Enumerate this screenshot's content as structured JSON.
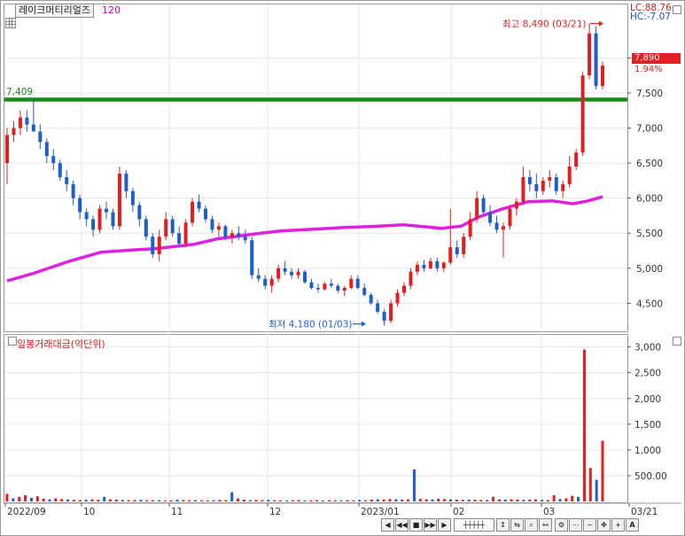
{
  "header": {
    "stock_name": "레이크머티리얼즈",
    "ma_period": "120",
    "lc_text": "LC:88.76",
    "hc_text": "HC:-7.07"
  },
  "price_panel": {
    "current_price": "7,890",
    "change_pct": "1.94%",
    "hline_value": 7409,
    "hline_label": "7,409",
    "max_label": "최고 8,490 (03/21)",
    "min_label": "최저 4,180 (01/03)",
    "y_ticks": [
      "8,000",
      "7,500",
      "7,000",
      "6,500",
      "6,000",
      "5,500",
      "5,000",
      "4,500"
    ]
  },
  "volume_panel": {
    "title": "일봉거래대금(억단위)",
    "y_ticks": [
      "3,000",
      "2,500",
      "2,000",
      "1,500",
      "1,000",
      "500.00"
    ]
  },
  "x_axis": {
    "labels": [
      "2022/09",
      "10",
      "11",
      "12",
      "2023/01",
      "02",
      "03"
    ],
    "end_label": "03/21"
  },
  "colors": {
    "up": "#e02020",
    "down": "#1f5fc8",
    "ma": "#e020e0",
    "hline": "#1a8a1a",
    "grid": "#e6e6e6"
  },
  "chart_data": [
    {
      "type": "candlestick",
      "title": "레이크머티리얼즈",
      "x_labels": [
        "2022/09",
        "10",
        "11",
        "12",
        "2023/01",
        "02",
        "03"
      ],
      "y_range": [
        4100,
        8700
      ],
      "hline": 7409,
      "ma_period": 120,
      "series": [
        {
          "name": "price",
          "ohlc": [
            [
              6500,
              7000,
              6200,
              6900
            ],
            [
              6900,
              7100,
              6800,
              7000
            ],
            [
              7000,
              7250,
              6900,
              7150
            ],
            [
              7150,
              7250,
              6950,
              7050
            ],
            [
              7050,
              7409,
              6950,
              6950
            ],
            [
              6950,
              7050,
              6700,
              6800
            ],
            [
              6800,
              6850,
              6500,
              6600
            ],
            [
              6600,
              6700,
              6400,
              6500
            ],
            [
              6500,
              6550,
              6250,
              6300
            ],
            [
              6300,
              6400,
              6100,
              6200
            ],
            [
              6200,
              6250,
              5900,
              6000
            ],
            [
              6000,
              6050,
              5700,
              5800
            ],
            [
              5800,
              5850,
              5600,
              5700
            ],
            [
              5700,
              5750,
              5450,
              5550
            ],
            [
              5550,
              5900,
              5500,
              5850
            ],
            [
              5850,
              5950,
              5700,
              5800
            ],
            [
              5800,
              5850,
              5550,
              5600
            ],
            [
              5600,
              6450,
              5550,
              6350
            ],
            [
              6350,
              6400,
              6000,
              6100
            ],
            [
              6100,
              6150,
              5800,
              5900
            ],
            [
              5900,
              5950,
              5600,
              5700
            ],
            [
              5700,
              5750,
              5400,
              5450
            ],
            [
              5450,
              5500,
              5150,
              5200
            ],
            [
              5200,
              5550,
              5100,
              5450
            ],
            [
              5450,
              5800,
              5400,
              5700
            ],
            [
              5700,
              5750,
              5450,
              5500
            ],
            [
              5500,
              5600,
              5300,
              5350
            ],
            [
              5350,
              5700,
              5300,
              5650
            ],
            [
              5650,
              6000,
              5600,
              5950
            ],
            [
              5950,
              6050,
              5800,
              5850
            ],
            [
              5850,
              5900,
              5650,
              5700
            ],
            [
              5700,
              5750,
              5500,
              5550
            ],
            [
              5550,
              5650,
              5450,
              5600
            ],
            [
              5600,
              5620,
              5400,
              5450
            ],
            [
              5450,
              5550,
              5350,
              5500
            ],
            [
              5500,
              5600,
              5400,
              5450
            ],
            [
              5450,
              5550,
              5350,
              5400
            ],
            [
              5400,
              5450,
              4850,
              4900
            ],
            [
              4900,
              5000,
              4800,
              4850
            ],
            [
              4850,
              4900,
              4700,
              4750
            ],
            [
              4750,
              4900,
              4650,
              4850
            ],
            [
              4850,
              5050,
              4800,
              5000
            ],
            [
              5000,
              5100,
              4900,
              4950
            ],
            [
              4950,
              5000,
              4850,
              4900
            ],
            [
              4900,
              5000,
              4850,
              4950
            ],
            [
              4950,
              4980,
              4780,
              4800
            ],
            [
              4800,
              4850,
              4700,
              4720
            ],
            [
              4720,
              4780,
              4650,
              4700
            ],
            [
              4700,
              4800,
              4680,
              4780
            ],
            [
              4780,
              4850,
              4720,
              4750
            ],
            [
              4750,
              4780,
              4650,
              4680
            ],
            [
              4680,
              4750,
              4600,
              4720
            ],
            [
              4720,
              4900,
              4700,
              4850
            ],
            [
              4850,
              4900,
              4700,
              4720
            ],
            [
              4720,
              4780,
              4600,
              4620
            ],
            [
              4620,
              4650,
              4480,
              4500
            ],
            [
              4500,
              4550,
              4350,
              4380
            ],
            [
              4380,
              4420,
              4180,
              4250
            ],
            [
              4250,
              4550,
              4220,
              4500
            ],
            [
              4500,
              4700,
              4450,
              4650
            ],
            [
              4650,
              4800,
              4600,
              4750
            ],
            [
              4750,
              5000,
              4700,
              4950
            ],
            [
              4950,
              5100,
              4900,
              5050
            ],
            [
              5050,
              5120,
              4950,
              5000
            ],
            [
              5000,
              5150,
              4980,
              5100
            ],
            [
              5100,
              5150,
              4950,
              5000
            ],
            [
              5000,
              5100,
              4950,
              5080
            ],
            [
              5080,
              5850,
              5050,
              5300
            ],
            [
              5300,
              5400,
              5150,
              5200
            ],
            [
              5200,
              5500,
              5150,
              5450
            ],
            [
              5450,
              5800,
              5400,
              5700
            ],
            [
              5700,
              6100,
              5650,
              6000
            ],
            [
              6000,
              6050,
              5750,
              5800
            ],
            [
              5800,
              5900,
              5600,
              5650
            ],
            [
              5650,
              5750,
              5500,
              5550
            ],
            [
              5550,
              5650,
              5150,
              5600
            ],
            [
              5600,
              5900,
              5550,
              5850
            ],
            [
              5850,
              6000,
              5750,
              5950
            ],
            [
              5950,
              6450,
              5900,
              6300
            ],
            [
              6300,
              6400,
              6100,
              6200
            ],
            [
              6200,
              6350,
              6000,
              6100
            ],
            [
              6100,
              6300,
              6050,
              6250
            ],
            [
              6250,
              6400,
              6150,
              6300
            ],
            [
              6300,
              6350,
              6050,
              6100
            ],
            [
              6100,
              6250,
              6000,
              6200
            ],
            [
              6200,
              6600,
              6150,
              6450
            ],
            [
              6450,
              6700,
              6400,
              6650
            ],
            [
              6650,
              7800,
              6600,
              7750
            ],
            [
              7750,
              8490,
              7700,
              8350
            ],
            [
              8350,
              8450,
              7550,
              7600
            ],
            [
              7600,
              7950,
              7550,
              7890
            ]
          ]
        },
        {
          "name": "MA120",
          "values_by_index": [
            [
              0,
              4820
            ],
            [
              10,
              4920
            ],
            [
              25,
              5100
            ],
            [
              38,
              5230
            ],
            [
              50,
              5260
            ],
            [
              60,
              5280
            ],
            [
              75,
              5340
            ],
            [
              85,
              5420
            ],
            [
              100,
              5490
            ],
            [
              110,
              5530
            ],
            [
              125,
              5560
            ],
            [
              135,
              5580
            ],
            [
              150,
              5600
            ],
            [
              160,
              5620
            ],
            [
              175,
              5570
            ],
            [
              183,
              5600
            ],
            [
              190,
              5730
            ],
            [
              200,
              5850
            ],
            [
              210,
              5950
            ],
            [
              220,
              5960
            ],
            [
              228,
              5920
            ],
            [
              234,
              5960
            ],
            [
              240,
              6020
            ]
          ]
        }
      ]
    },
    {
      "type": "bar",
      "title": "일봉거래대금(억단위)",
      "y_range": [
        0,
        3200
      ],
      "series": [
        {
          "name": "일봉거래대금(억단위)",
          "values": [
            150,
            60,
            90,
            120,
            70,
            100,
            55,
            40,
            60,
            45,
            38,
            30,
            28,
            36,
            42,
            33,
            90,
            40,
            36,
            30,
            25,
            28,
            32,
            22,
            26,
            24,
            20,
            22,
            35,
            28,
            24,
            26,
            22,
            20,
            24,
            32,
            28,
            180,
            60,
            35,
            26,
            30,
            28,
            32,
            24,
            22,
            20,
            24,
            28,
            20,
            22,
            26,
            20,
            24,
            22,
            20,
            26,
            22,
            28,
            24,
            36,
            40,
            38,
            46,
            42,
            36,
            40,
            620,
            48,
            42,
            38,
            55,
            46,
            40,
            36,
            32,
            38,
            34,
            30,
            28,
            90,
            40,
            36,
            42,
            38,
            32,
            36,
            40,
            30,
            28,
            120,
            48,
            60,
            110,
            90,
            2950,
            650,
            420,
            1180
          ]
        }
      ]
    }
  ]
}
